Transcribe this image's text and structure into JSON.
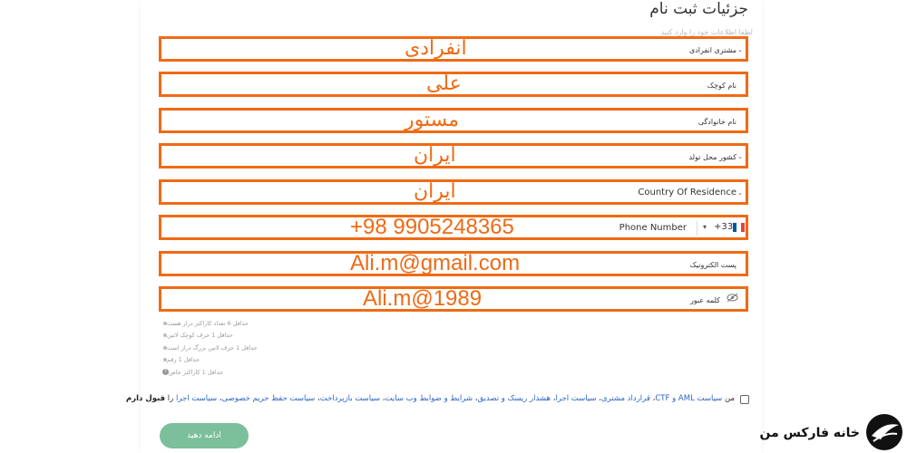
{
  "page": {
    "title": "جزئیات ثبت نام",
    "subtitle": "لطفا اطلاعات خود را وارد کنید"
  },
  "fields": [
    {
      "label": "مشتری انفرادی",
      "value": "انفرادی"
    },
    {
      "label": "نام کوچک",
      "value": "علی"
    },
    {
      "label": "نام خانوادگی",
      "value": "مستور"
    },
    {
      "label": "کشور محل تولد",
      "value": "ایران"
    },
    {
      "label": "Country Of Residence",
      "value": "ایران"
    },
    {
      "label": "Phone Number",
      "value": "+98 9905248365",
      "country_code": "+33"
    },
    {
      "label": "پست الکترونیک",
      "value": "Ali.m@gmail.com"
    },
    {
      "label": "کلمه عبور",
      "value": "Ali.m@1989"
    }
  ],
  "password_rules": [
    "حداقل 6 تعداد کاراکتر دراز هست",
    "حداقل 1 حرف کوچک لاتین",
    "حداقل 1 حرف لاتین بزرگ دراز است",
    "حداقل 1 رقم",
    "حداقل 1 کاراکتر خاص"
  ],
  "agreement": {
    "prefix": "من",
    "link1": "سیاست AML و CTF",
    "sep": "،",
    "link2": "قرارداد مشتری",
    "link3": "سیاست اجرا",
    "link4": "هشدار ریسک و تصدیق",
    "link5": "شرایط و ضوابط وب سایت",
    "link6": "سیاست بازپرداخت",
    "link7": "سیاست حفظ حریم خصوصی",
    "link8": "سیاست اجرا",
    "suffix_plain": "را",
    "suffix_bold": "قبول دارم"
  },
  "submit_label": "ادامه دهید",
  "brand": {
    "name": "خانه فارکس من"
  },
  "colors": {
    "highlight": "#ef6a14",
    "button": "#7bbf9b",
    "link": "#2b63c4"
  }
}
